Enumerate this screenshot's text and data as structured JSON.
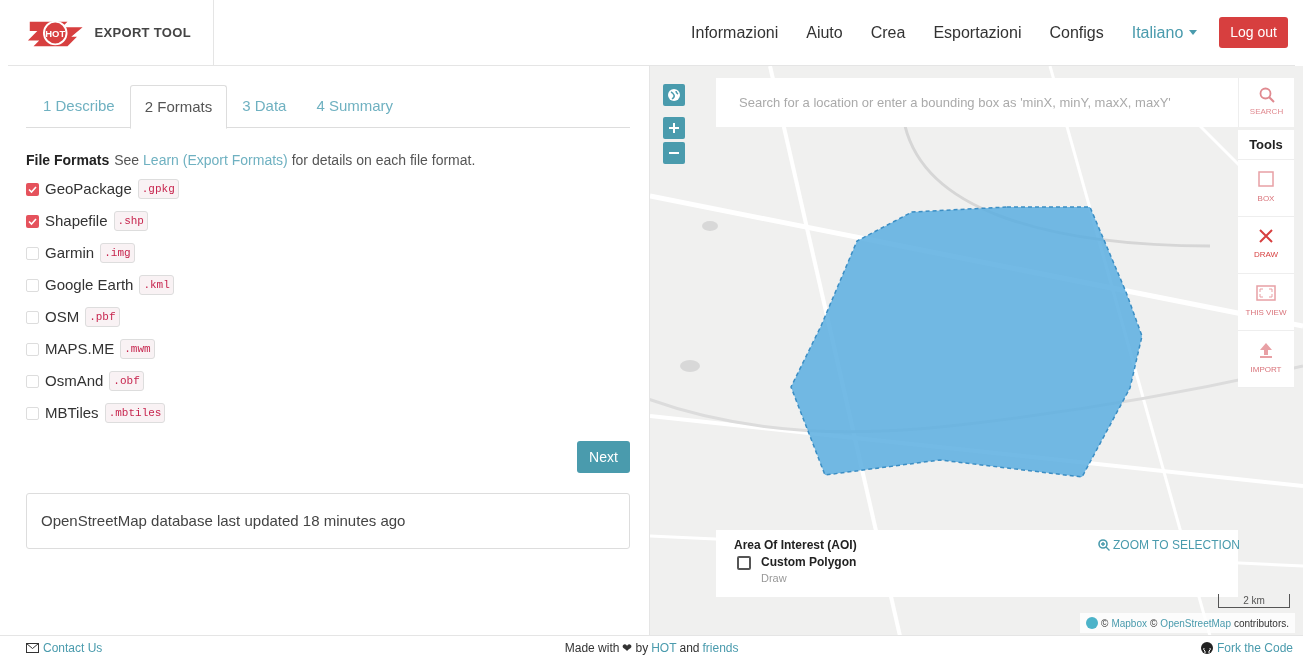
{
  "header": {
    "brand_badge": "HOT",
    "brand": "EXPORT TOOL",
    "nav": [
      {
        "label": "Informazioni",
        "kind": "link"
      },
      {
        "label": "Aiuto",
        "kind": "link"
      },
      {
        "label": "Crea",
        "kind": "link"
      },
      {
        "label": "Esportazioni",
        "kind": "link"
      },
      {
        "label": "Configs",
        "kind": "link"
      },
      {
        "label": "Italiano",
        "kind": "dropdown"
      }
    ],
    "logout": "Log out"
  },
  "tabs": [
    {
      "label": "1 Describe",
      "selected": false
    },
    {
      "label": "2 Formats",
      "selected": true
    },
    {
      "label": "3 Data",
      "selected": false
    },
    {
      "label": "4 Summary",
      "selected": false
    }
  ],
  "file_formats": {
    "title": "File Formats",
    "see": "See",
    "link": "Learn (Export Formats)",
    "rest": "for details on each file format.",
    "items": [
      {
        "label": "GeoPackage",
        "ext": ".gpkg",
        "checked": true
      },
      {
        "label": "Shapefile",
        "ext": ".shp",
        "checked": true
      },
      {
        "label": "Garmin",
        "ext": ".img",
        "checked": false
      },
      {
        "label": "Google Earth",
        "ext": ".kml",
        "checked": false
      },
      {
        "label": "OSM",
        "ext": ".pbf",
        "checked": false
      },
      {
        "label": "MAPS.ME",
        "ext": ".mwm",
        "checked": false
      },
      {
        "label": "OsmAnd",
        "ext": ".obf",
        "checked": false
      },
      {
        "label": "MBTiles",
        "ext": ".mbtiles",
        "checked": false
      }
    ]
  },
  "next_button": "Next",
  "status_note": "OpenStreetMap database last updated 18 minutes ago",
  "map": {
    "search": {
      "placeholder": "Search for a location or enter a bounding box as 'minX, minY, maxX, maxY'",
      "button": "SEARCH",
      "disabled": true
    },
    "tools_title": "Tools",
    "tools": [
      {
        "kind": "box",
        "label": "BOX",
        "disabled": true
      },
      {
        "kind": "draw",
        "label": "DRAW",
        "disabled": false
      },
      {
        "kind": "view",
        "label": "THIS VIEW",
        "disabled": true
      },
      {
        "kind": "import",
        "label": "IMPORT",
        "disabled": true
      }
    ],
    "aoi": {
      "title": "Area Of Interest (AOI)",
      "zoom": "ZOOM TO SELECTION",
      "name": "Custom Polygon",
      "sub": "Draw",
      "checked": false
    },
    "scale": "2 km",
    "attribution": [
      {
        "text": "©",
        "kind": "text"
      },
      {
        "text": "Mapbox",
        "kind": "link"
      },
      {
        "text": "©",
        "kind": "text"
      },
      {
        "text": "OpenStreetMap",
        "kind": "link"
      },
      {
        "text": "contributors.",
        "kind": "text"
      }
    ]
  },
  "footer": {
    "contact": "Contact Us",
    "made": [
      {
        "text": "Made with",
        "kind": "text"
      },
      {
        "text": "❤",
        "kind": "text"
      },
      {
        "text": "by",
        "kind": "text"
      },
      {
        "text": "HOT",
        "kind": "link"
      },
      {
        "text": "and",
        "kind": "text"
      },
      {
        "text": "friends",
        "kind": "link"
      }
    ],
    "fork": "Fork the Code"
  }
}
